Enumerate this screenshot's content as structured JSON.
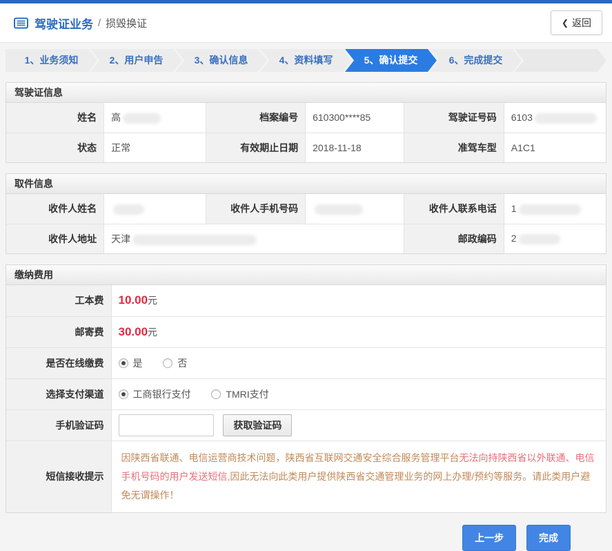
{
  "header": {
    "title": "驾驶证业务",
    "divider": "/",
    "subtitle": "损毁换证",
    "back_chevron": "❮",
    "back_label": "返回"
  },
  "steps": [
    {
      "label": "1、业务须知",
      "active": false
    },
    {
      "label": "2、用户申告",
      "active": false
    },
    {
      "label": "3、确认信息",
      "active": false
    },
    {
      "label": "4、资料填写",
      "active": false
    },
    {
      "label": "5、确认提交",
      "active": true
    },
    {
      "label": "6、完成提交",
      "active": false
    }
  ],
  "license_section": {
    "title": "驾驶证信息",
    "fields": {
      "name": {
        "label": "姓名",
        "value": "高"
      },
      "file_number": {
        "label": "档案编号",
        "value": "610300****85"
      },
      "license_number": {
        "label": "驾驶证号码",
        "value": "6103"
      },
      "status": {
        "label": "状态",
        "value": "正常"
      },
      "valid_until": {
        "label": "有效期止日期",
        "value": "2018-11-18"
      },
      "vehicle_class": {
        "label": "准驾车型",
        "value": "A1C1"
      }
    }
  },
  "pickup_section": {
    "title": "取件信息",
    "fields": {
      "recipient_name": {
        "label": "收件人姓名",
        "value": ""
      },
      "recipient_mobile": {
        "label": "收件人手机号码",
        "value": ""
      },
      "recipient_phone": {
        "label": "收件人联系电话",
        "value": "1"
      },
      "recipient_address": {
        "label": "收件人地址",
        "value": "天津"
      },
      "postal_code": {
        "label": "邮政编码",
        "value": "2"
      }
    }
  },
  "fees_section": {
    "title": "缴纳费用",
    "production_fee": {
      "label": "工本费",
      "amount": "10.00",
      "unit": "元"
    },
    "postage_fee": {
      "label": "邮寄费",
      "amount": "30.00",
      "unit": "元"
    },
    "online_payment": {
      "label": "是否在线缴费",
      "options": [
        {
          "label": "是",
          "selected": true
        },
        {
          "label": "否",
          "selected": false
        }
      ]
    },
    "payment_channel": {
      "label": "选择支付渠道",
      "options": [
        {
          "label": "工商银行支付",
          "selected": true
        },
        {
          "label": "TMRI支付",
          "selected": false
        }
      ]
    },
    "sms_code": {
      "label": "手机验证码",
      "input_value": "",
      "button_label": "获取验证码"
    },
    "sms_notice": {
      "label": "短信接收提示",
      "text_before": "因陕西省联通、电信运营商技术问题，陕西省互联网交通安全综合服务管理平台",
      "text_emphasis": "无法向持陕西省以外联通、电信手机号码的用户发送短信,",
      "text_after": "因此无法向此类用户提供陕西省交通管理业务的网上办理/预约等服务。请此类用户避免无谓操作！"
    }
  },
  "footer": {
    "prev_label": "上一步",
    "finish_label": "完成"
  },
  "colors": {
    "topbar_blue": "#2e68c0",
    "accent_blue": "#2b7ce2",
    "step_text_blue": "#3a6fc0",
    "fee_red": "#e02b43",
    "notice_base": "#c08a5a",
    "notice_emphasis": "#e8707a",
    "button_blue": "#4285e4"
  }
}
